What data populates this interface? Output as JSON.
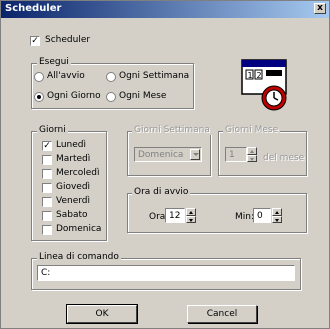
{
  "window": {
    "title": "Scheduler",
    "close_glyph": "x"
  },
  "scheduler_toggle": {
    "label": "Scheduler",
    "checked": true
  },
  "esegui": {
    "label": "Esegui",
    "options": [
      {
        "label": "All'avvio",
        "selected": false
      },
      {
        "label": "Ogni Settimana",
        "selected": false
      },
      {
        "label": "Ogni Giorno",
        "selected": true
      },
      {
        "label": "Ogni Mese",
        "selected": false
      }
    ]
  },
  "giorni": {
    "label": "Giorni",
    "days": [
      {
        "label": "Lunedì",
        "checked": true
      },
      {
        "label": "Martedì",
        "checked": false
      },
      {
        "label": "Mercoledì",
        "checked": false
      },
      {
        "label": "Giovedì",
        "checked": false
      },
      {
        "label": "Venerdì",
        "checked": false
      },
      {
        "label": "Sabato",
        "checked": false
      },
      {
        "label": "Domenica",
        "checked": false
      }
    ]
  },
  "giorni_settimana": {
    "label": "Giorni Settimana",
    "value": "Domenica"
  },
  "giorni_mese": {
    "label": "Giorni Mese",
    "value": "1",
    "suffix": "del mese"
  },
  "ora_di_avvio": {
    "label": "Ora di avvio",
    "hour_label": "Ora:",
    "hour_value": "12",
    "min_label": "Min:",
    "min_value": "0"
  },
  "linea_di_comando": {
    "label": "Linea di comando",
    "value": "C:"
  },
  "buttons": {
    "ok": "OK",
    "cancel": "Cancel"
  },
  "icon": "calendar-clock-icon"
}
